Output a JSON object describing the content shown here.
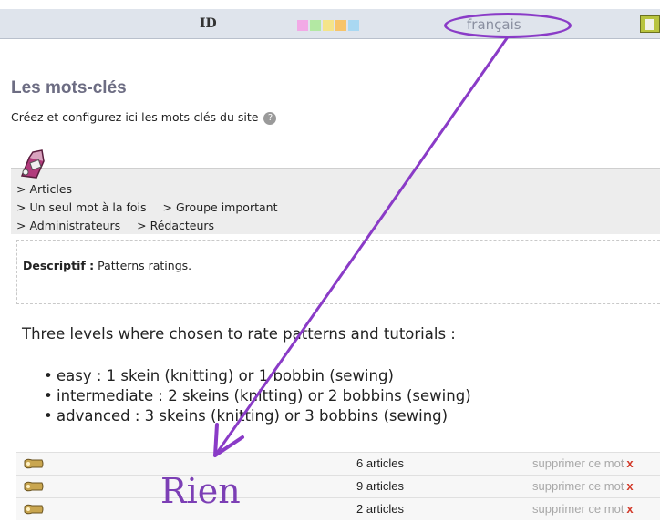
{
  "topbar": {
    "id_label": "ID",
    "swatch_colors": [
      "#f2a9e6",
      "#b3e8a3",
      "#f4e48a",
      "#f7c46a",
      "#a9d8f2"
    ],
    "language": "français"
  },
  "page": {
    "title": "Les mots-clés",
    "description": "Créez et configurez ici les mots-clés du site"
  },
  "group": {
    "breadcrumbs": [
      [
        "> Articles"
      ],
      [
        "> Un seul mot à la fois",
        "> Groupe important"
      ],
      [
        "> Administrateurs",
        "> Rédacteurs"
      ]
    ]
  },
  "descriptif": {
    "label": "Descriptif :",
    "text": "Patterns ratings."
  },
  "levels": {
    "title": "Three levels where chosen to rate patterns and tutorials :",
    "items": [
      "easy : 1 skein (knitting) or 1 bobbin (sewing)",
      "intermediate : 2 skeins (knitting) or 2 bobbins (sewing)",
      "advanced : 3 skeins (knitting) or 3 bobbins (sewing)"
    ]
  },
  "keywords": [
    {
      "count": "6 articles",
      "delete_label": "supprimer ce mot"
    },
    {
      "count": "9 articles",
      "delete_label": "supprimer ce mot"
    },
    {
      "count": "2 articles",
      "delete_label": "supprimer ce mot"
    }
  ],
  "annotation": {
    "text": "Rien",
    "color": "#7c3fb5"
  }
}
